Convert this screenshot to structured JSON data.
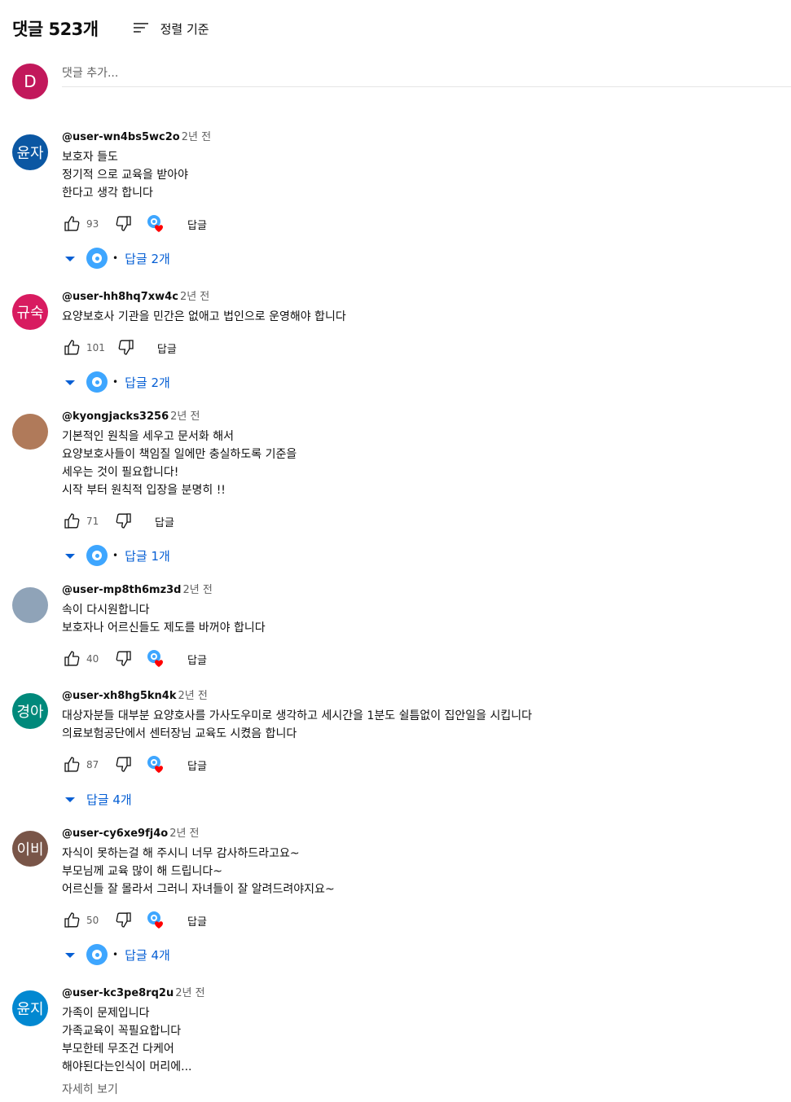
{
  "header": {
    "count": "댓글 523개",
    "sort_label": "정렬 기준"
  },
  "add_comment": {
    "avatar_letter": "D",
    "avatar_color": "#c2185b",
    "placeholder": "댓글 추가..."
  },
  "reply_label": "답글",
  "read_more": "자세히 보기",
  "comments": [
    {
      "avatar_text": "윤자",
      "avatar_color": "#0b57a3",
      "handle": "@user-wn4bs5wc2o",
      "time": "2년 전",
      "text": "보호자 들도\n정기적 으로 교육을 받아야\n한다고 생각 합니다",
      "likes": "93",
      "heart": true,
      "replies": "답글 2개",
      "reply_avatar": true
    },
    {
      "avatar_text": "규숙",
      "avatar_color": "#d81b60",
      "handle": "@user-hh8hq7xw4c",
      "time": "2년 전",
      "text": "요양보호사 기관을 민간은 없애고 법인으로 운영해야 합니다",
      "likes": "101",
      "heart": false,
      "replies": "답글 2개",
      "reply_avatar": true
    },
    {
      "avatar_text": "",
      "avatar_color": "#b07a5a",
      "handle": "@kyongjacks3256",
      "time": "2년 전",
      "text": "기본적인 원칙을 세우고 문서화 해서\n요양보호사들이 책임질 일에만 충실하도록 기준을\n세우는 것이 필요합니다!\n시작 부터 원칙적 입장을 분명히 !!",
      "likes": "71",
      "heart": false,
      "replies": "답글 1개",
      "reply_avatar": true
    },
    {
      "avatar_text": "",
      "avatar_color": "#8fa3b8",
      "handle": "@user-mp8th6mz3d",
      "time": "2년 전",
      "text": "속이 다시원합니다\n보호자나 어르신들도 제도를 바꺼야 합니다",
      "likes": "40",
      "heart": true,
      "replies": "",
      "reply_avatar": false
    },
    {
      "avatar_text": "경아",
      "avatar_color": "#00897b",
      "handle": "@user-xh8hg5kn4k",
      "time": "2년 전",
      "text": "대상자분들 대부분 요양호사를 가사도우미로 생각하고 세시간을 1분도 쉴틈없이  집안일을 시킵니다\n의료보험공단에서 센터장님 교육도  시켰음 합니다",
      "likes": "87",
      "heart": true,
      "replies": "답글 4개",
      "reply_avatar": false
    },
    {
      "avatar_text": "이비",
      "avatar_color": "#795548",
      "handle": "@user-cy6xe9fj4o",
      "time": "2년 전",
      "text": "자식이 못하는걸 해 주시니 너무 감사하드라고요~\n부모님께 교육 많이 해 드립니다~\n어르신들 잘 몰라서 그러니 자녀들이 잘 알려드려야지요~",
      "likes": "50",
      "heart": true,
      "replies": "답글 4개",
      "reply_avatar": true
    },
    {
      "avatar_text": "윤지",
      "avatar_color": "#0288d1",
      "handle": "@user-kc3pe8rq2u",
      "time": "2년 전",
      "text": "가족이  문제입니다\n가족교육이  꼭필요합니다\n부모한테  무조건  다케어\n해야된다는인식이  머리에...",
      "likes": "",
      "heart": false,
      "replies": "",
      "reply_avatar": false,
      "truncated": true
    }
  ]
}
